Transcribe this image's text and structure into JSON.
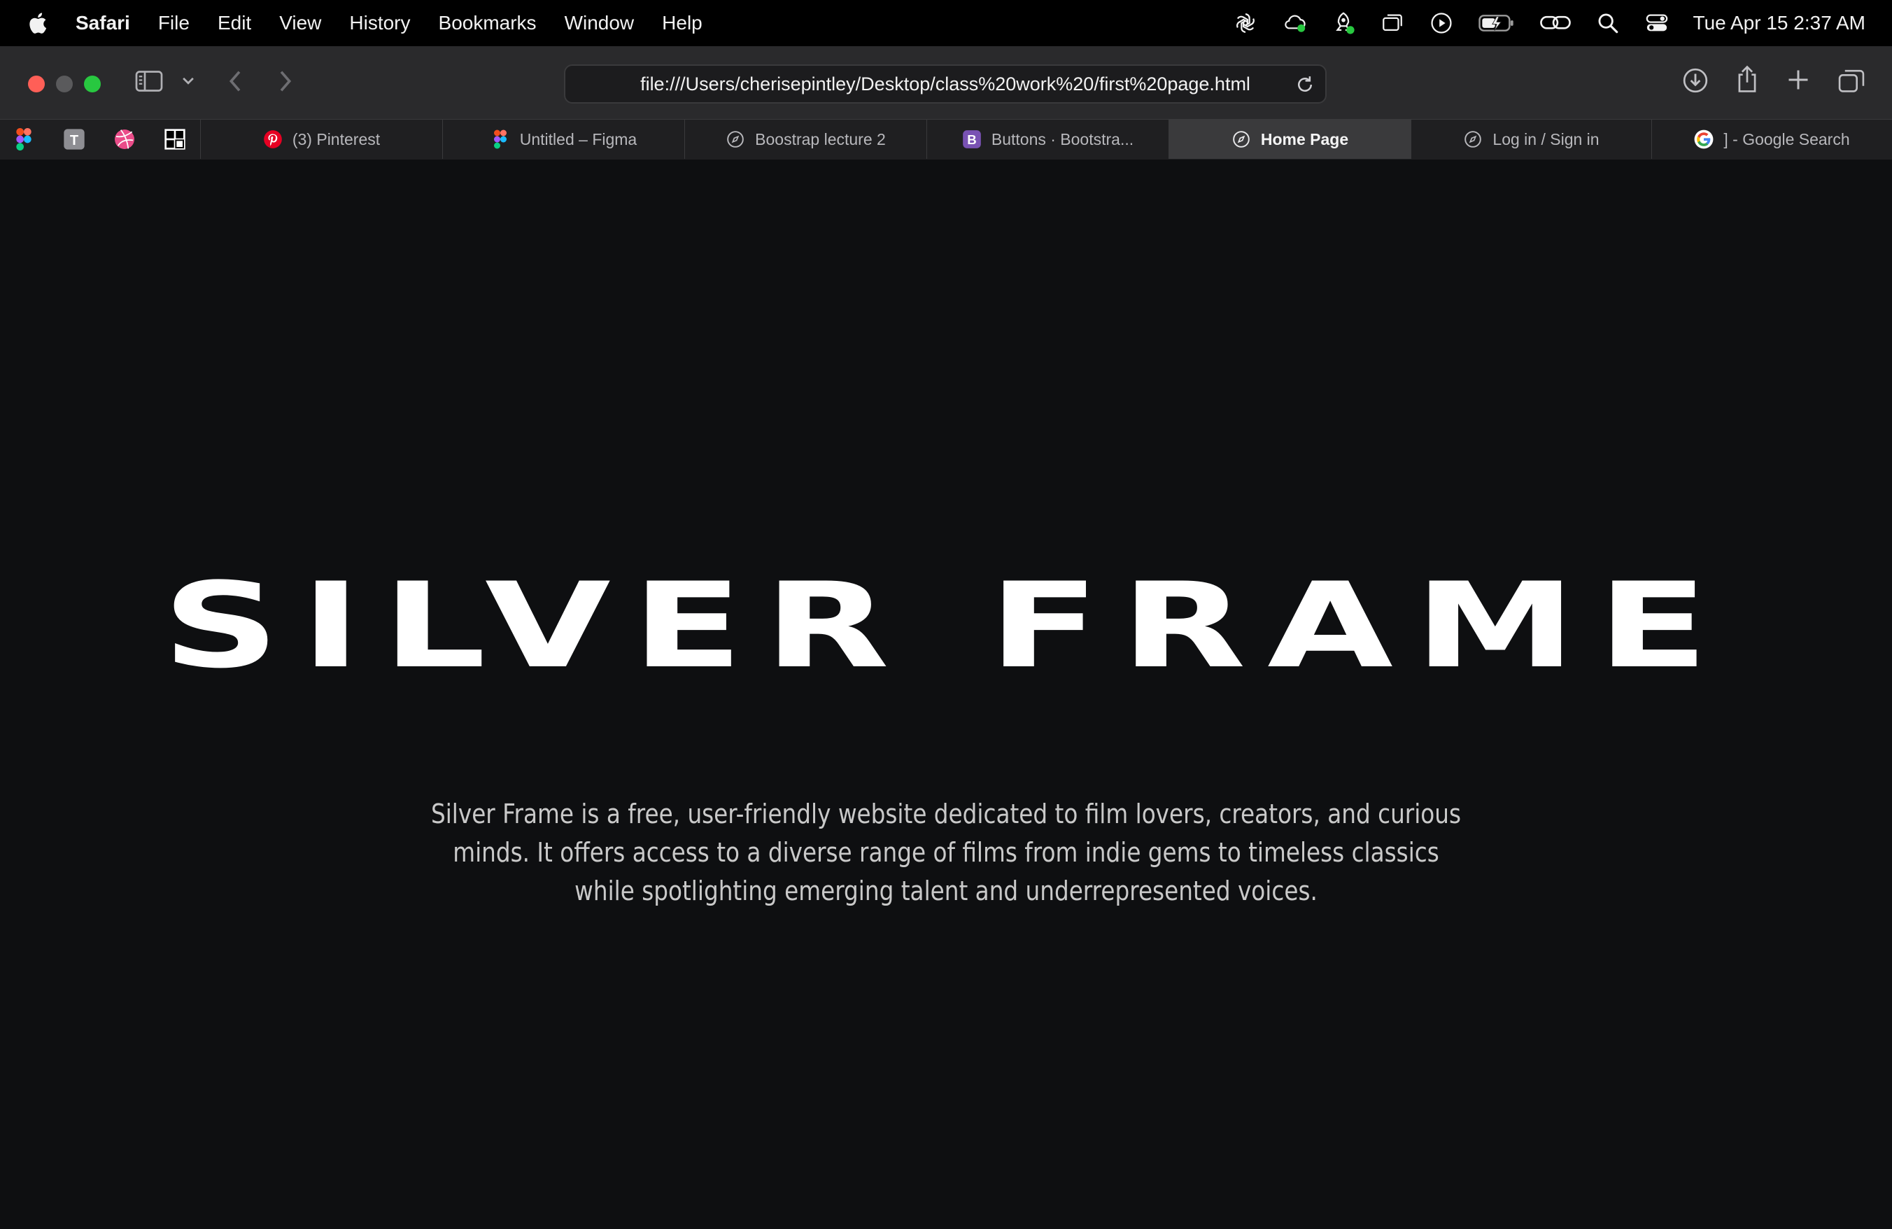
{
  "menubar": {
    "app_name": "Safari",
    "items": [
      "File",
      "Edit",
      "View",
      "History",
      "Bookmarks",
      "Window",
      "Help"
    ],
    "clock": "Tue Apr 15  2:37 AM",
    "status_icons": [
      "chatgpt-icon",
      "cloud-sync-icon",
      "rocket-icon",
      "screens-icon",
      "play-icon",
      "battery-charging-icon",
      "link-icon",
      "spotlight-search-icon",
      "control-center-icon"
    ]
  },
  "toolbar": {
    "url": "file:///Users/cherisepintley/Desktop/class%20work%20/first%20page.html"
  },
  "tabs": {
    "pinned": [
      "figma-icon",
      "t-icon",
      "dribbble-icon",
      "checker-icon"
    ],
    "items": [
      {
        "label": "(3) Pinterest",
        "icon": "pinterest-icon"
      },
      {
        "label": "Untitled – Figma",
        "icon": "figma-icon"
      },
      {
        "label": "Boostrap lecture 2",
        "icon": "compass-icon"
      },
      {
        "label": "Buttons · Bootstra...",
        "icon": "bootstrap-icon"
      },
      {
        "label": "Home Page",
        "icon": "compass-icon",
        "active": true
      },
      {
        "label": "Log in / Sign in",
        "icon": "compass-icon"
      },
      {
        "label": "] - Google Search",
        "icon": "google-icon"
      }
    ]
  },
  "page": {
    "title": "SILVER FRAME",
    "description": "Silver Frame is a free, user-friendly website dedicated to film lovers, creators, and curious minds. It offers access to a diverse range of films from indie gems to timeless classics while spotlighting emerging talent and underrepresented voices."
  }
}
